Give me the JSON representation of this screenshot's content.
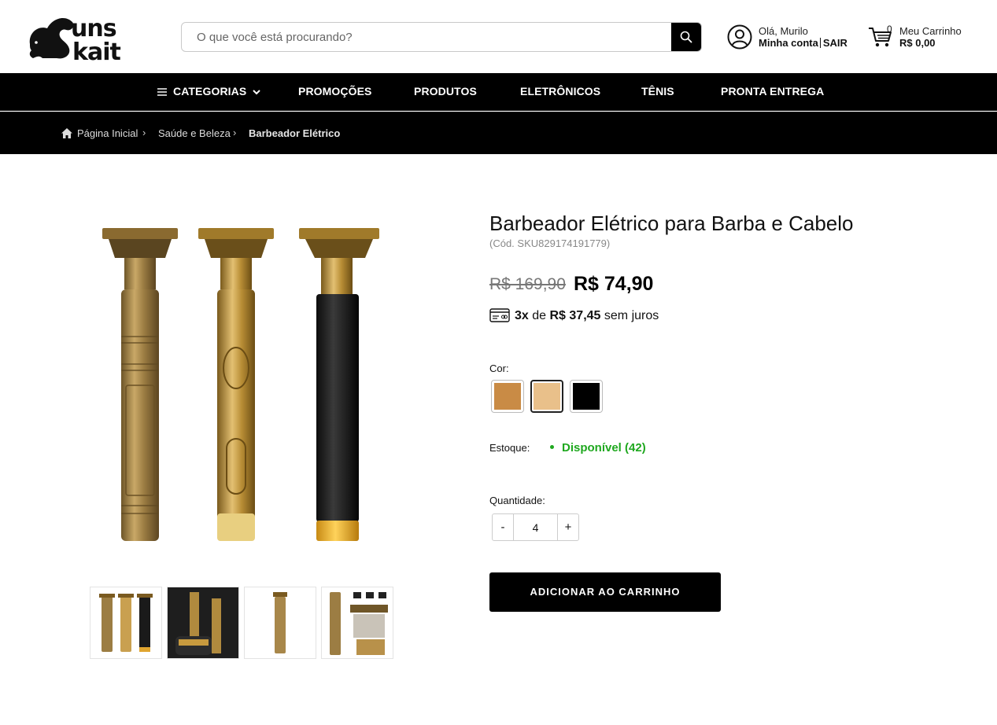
{
  "header": {
    "logo_text": "Suns Kait",
    "search_placeholder": "O que você está procurando?",
    "account": {
      "greeting": "Olá, Murilo",
      "my_account": "Minha conta",
      "logout": "SAIR"
    },
    "cart": {
      "count": "0",
      "title": "Meu Carrinho",
      "total": "R$ 0,00"
    }
  },
  "nav": {
    "items": [
      "CATEGORIAS",
      "PROMOÇÕES",
      "PRODUTOS",
      "ELETRÔNICOS",
      "TÊNIS",
      "PRONTA ENTREGA"
    ]
  },
  "breadcrumb": {
    "items": [
      "Página Inicial",
      "Saúde e Beleza",
      "Barbeador Elétrico"
    ],
    "separator": "›"
  },
  "product": {
    "title": "Barbeador Elétrico para Barba e Cabelo",
    "sku": "(Cód. SKU829174191779)",
    "old_price": "R$ 169,90",
    "price": "R$ 74,90",
    "installments": {
      "count": "3x",
      "connector": "de",
      "value": "R$ 37,45",
      "suffix": "sem juros"
    },
    "color_label": "Cor:",
    "colors": [
      {
        "name": "gold",
        "hex": "#c98b45"
      },
      {
        "name": "light-gold",
        "hex": "#e9c08a"
      },
      {
        "name": "black",
        "hex": "#000000"
      }
    ],
    "stock_label": "Estoque:",
    "stock_value": "Disponível (42)",
    "quantity_label": "Quantidade:",
    "quantity": "4",
    "qty_minus": "-",
    "qty_plus": "+",
    "add_to_cart": "ADICIONAR AO CARRINHO"
  },
  "colors": {
    "brand": "#000000",
    "stock_green": "#1fa81f",
    "gold": "#b8903a"
  }
}
